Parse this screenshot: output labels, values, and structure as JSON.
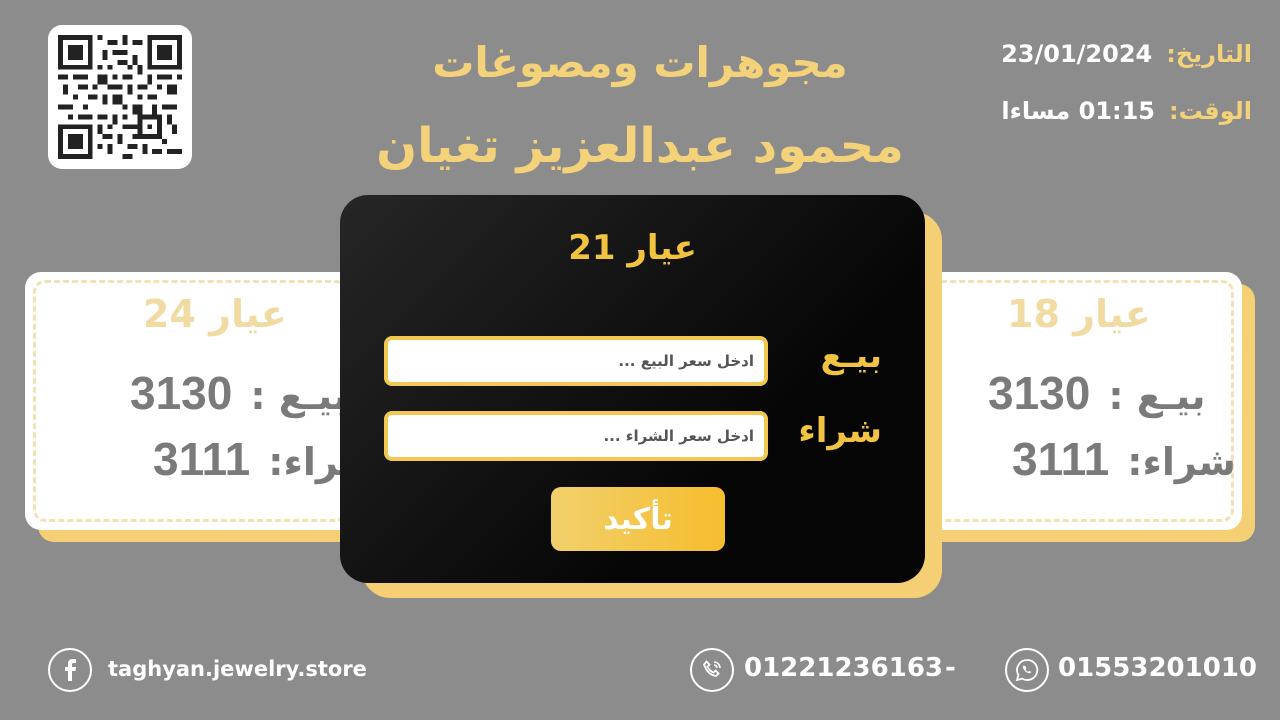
{
  "header": {
    "title_line1": "مجوهرات ومصوغات",
    "title_line2": "محمود عبدالعزيز تغيان",
    "date_label": "التاريخ:",
    "date_value": "23/01/2024",
    "time_label": "الوقت:",
    "time_value": "01:15 مساءا"
  },
  "qr": {
    "icon": "qr-code"
  },
  "left_card": {
    "title": "عيار 24",
    "sell_label": "بيـع :",
    "sell_value": "3130",
    "buy_label": "شراء:",
    "buy_value": "3111"
  },
  "right_card": {
    "title": "عيار 18",
    "sell_label": "بيـع :",
    "sell_value": "3130",
    "buy_label": "شراء:",
    "buy_value": "3111"
  },
  "modal": {
    "title": "عيار 21",
    "sell_label": "بيـع",
    "sell_placeholder": "ادخل سعر البيع ...",
    "buy_label": "شراء",
    "buy_placeholder": "ادخل سعر الشراء ...",
    "confirm_label": "تأكيد"
  },
  "footer": {
    "facebook_icon": "facebook-icon",
    "facebook_handle": "taghyan.jewelry.store",
    "phone_icon": "phone-icon",
    "phone": "01221236163",
    "separator": "-",
    "whatsapp_icon": "whatsapp-icon",
    "whatsapp": "01553201010"
  },
  "colors": {
    "background": "#8c8c8c",
    "gold": "#f4d27a",
    "gold_strong": "#f2c341",
    "modal_bg": "#0a0a0a"
  }
}
